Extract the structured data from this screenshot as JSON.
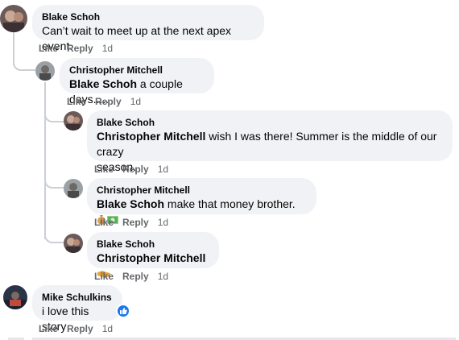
{
  "comments": [
    {
      "author": "Blake Schoh",
      "text": "Can’t wait to meet up at the next apex event.",
      "actions": {
        "like": "Like",
        "reply": "Reply",
        "time": "1d"
      }
    },
    {
      "author": "Christopher Mitchell",
      "mention": "Blake Schoh",
      "text": " a couple days.....",
      "actions": {
        "like": "Like",
        "reply": "Reply",
        "time": "1d"
      }
    },
    {
      "author": "Blake Schoh",
      "mention": "Christopher Mitchell",
      "text_line1": " wish I was there! Summer is the middle of our crazy",
      "text_line2": "season.",
      "actions": {
        "like": "Like",
        "reply": "Reply",
        "time": "1d"
      }
    },
    {
      "author": "Christopher Mitchell",
      "mention": "Blake Schoh",
      "text": " make that money brother.",
      "actions": {
        "like": "Like",
        "reply": "Reply",
        "time": "1d"
      }
    },
    {
      "author": "Blake Schoh",
      "mention": "Christopher Mitchell",
      "actions": {
        "like": "Like",
        "reply": "Reply",
        "time": "1d"
      }
    },
    {
      "author": "Mike Schulkins",
      "text": "i love this story",
      "actions": {
        "like": "Like",
        "reply": "Reply",
        "time": "1d"
      }
    }
  ],
  "colors": {
    "bubble": "#f0f2f5",
    "secondary_text": "#65676b",
    "like_blue": "#1877f2",
    "thread_line": "#ccd0d5"
  },
  "icons": [
    "avatar-blake",
    "avatar-christopher",
    "avatar-mike",
    "money-bag-emoji",
    "cash-emoji",
    "handshake-emoji",
    "like-reaction-icon"
  ]
}
